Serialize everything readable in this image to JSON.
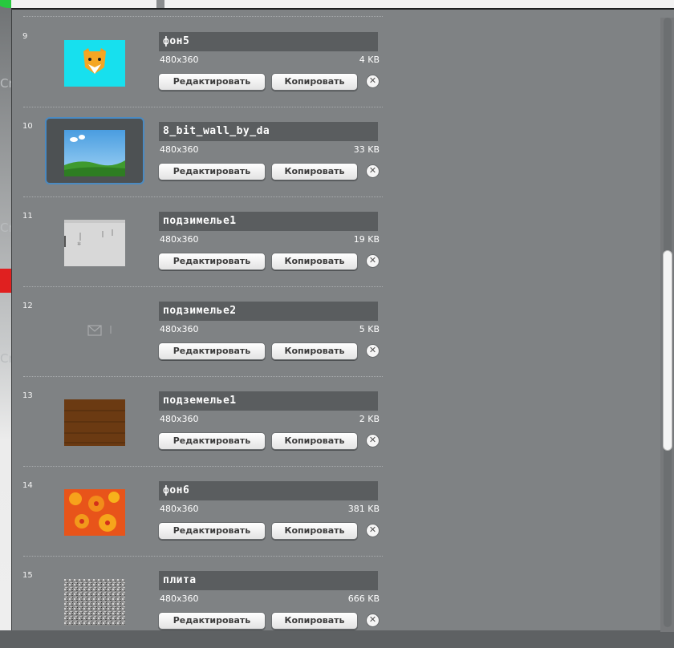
{
  "background": {
    "letters": [
      "Cr",
      "Cr",
      "Cr"
    ]
  },
  "buttons": {
    "edit": "Редактировать",
    "copy": "Копировать",
    "delete_icon": "close-icon"
  },
  "backdrops": [
    {
      "number": "9",
      "name": "фон5",
      "dims": "480x360",
      "size": "4 KB",
      "thumb": "fox-icon"
    },
    {
      "number": "10",
      "name": "8_bit_wall_by_da",
      "dims": "480x360",
      "size": "33 KB",
      "thumb": "sky-grass",
      "selected": true
    },
    {
      "number": "11",
      "name": "подзимелье1",
      "dims": "480x360",
      "size": "19 KB",
      "thumb": "gray-wall"
    },
    {
      "number": "12",
      "name": "подзимелье2",
      "dims": "480x360",
      "size": "5 KB",
      "thumb": "envelope"
    },
    {
      "number": "13",
      "name": "подземелье1",
      "dims": "480x360",
      "size": "2 KB",
      "thumb": "wood"
    },
    {
      "number": "14",
      "name": "фон6",
      "dims": "480x360",
      "size": "381 KB",
      "thumb": "red-flowers"
    },
    {
      "number": "15",
      "name": "плита",
      "dims": "480x360",
      "size": "666 KB",
      "thumb": "gray-noise"
    }
  ]
}
